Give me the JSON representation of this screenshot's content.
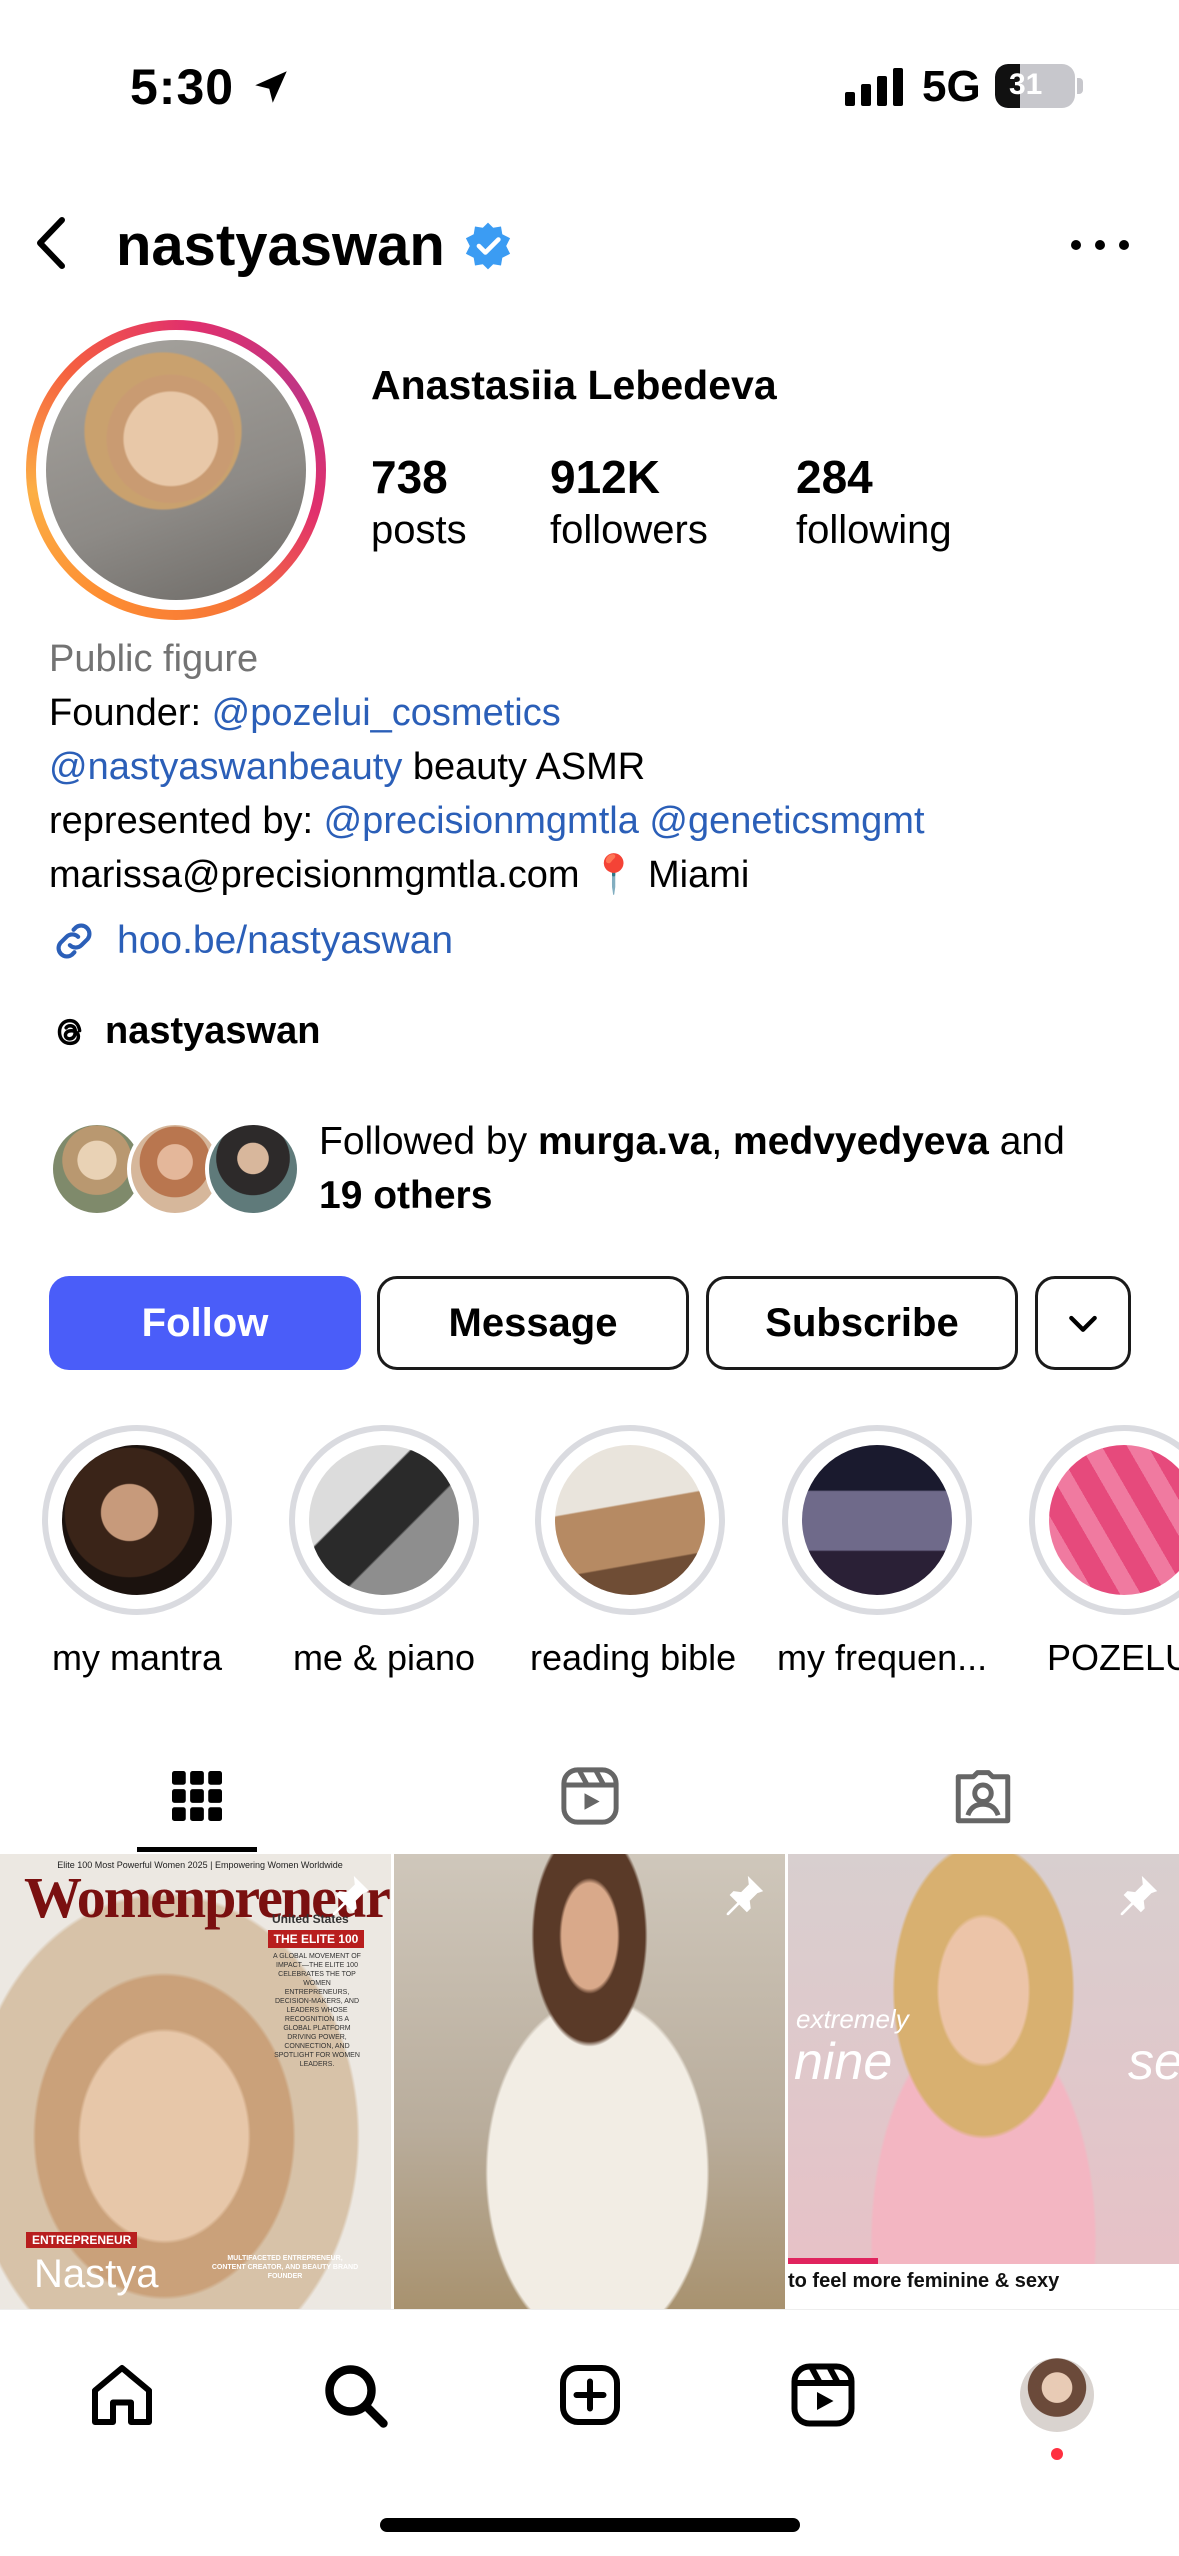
{
  "status_bar": {
    "time": "5:30",
    "network": "5G",
    "battery": "31",
    "battery_level": 0.31
  },
  "header": {
    "username": "nastyaswan"
  },
  "profile": {
    "full_name": "Anastasiia Lebedeva",
    "stats": [
      {
        "value": "738",
        "label": "posts"
      },
      {
        "value": "912K",
        "label": "followers"
      },
      {
        "value": "284",
        "label": "following"
      }
    ],
    "category": "Public figure",
    "bio": {
      "line1_prefix": "Founder: ",
      "line1_mention": "@pozelui_cosmetics",
      "line2_mention": "@nastyaswanbeauty",
      "line2_suffix": " beauty ASMR",
      "line3_prefix": "represented by: ",
      "line3_mention1": "@precisionmgmtla",
      "line3_mention2": "@geneticsmgmt",
      "line4": "marissa@precisionmgmtla.com 📍 Miami"
    },
    "link": "hoo.be/nastyaswan",
    "threads_name": "nastyaswan",
    "followed_by": {
      "prefix": "Followed by ",
      "user1": "murga.va",
      "separator": ", ",
      "user2": "medvyedyeva",
      "and": " and",
      "others": "19 others"
    }
  },
  "buttons": {
    "follow": "Follow",
    "message": "Message",
    "subscribe": "Subscribe"
  },
  "highlights": [
    {
      "label": "my mantra"
    },
    {
      "label": "me & piano"
    },
    {
      "label": "reading bible"
    },
    {
      "label": "my frequen..."
    },
    {
      "label": "POZELUI"
    }
  ],
  "grid": {
    "post1": {
      "masthead": "Womenpreneur",
      "top_line": "Elite 100 Most Powerful Women 2025 | Empowering Women Worldwide",
      "edition": "United States",
      "badge": "THE ELITE 100",
      "blurb": "A GLOBAL MOVEMENT OF IMPACT—THE ELITE 100 CELEBRATES THE TOP WOMEN ENTREPRENEURS, DECISION-MAKERS, AND LEADERS WHOSE RECOGNITION IS A GLOBAL PLATFORM DRIVING POWER, CONNECTION, AND SPOTLIGHT FOR WOMEN LEADERS.",
      "tag": "ENTREPRENEUR",
      "name": "Nastya",
      "footer": "MULTIFACETED ENTREPRENEUR, CONTENT CREATOR, AND BEAUTY BRAND FOUNDER"
    },
    "post3": {
      "overlay1": "extremely",
      "overlay2": "nine",
      "overlay3": "se",
      "caption": "to feel more feminine & sexy"
    }
  },
  "colors": {
    "follow_button": "#4a5df9",
    "link": "#2b5fb8",
    "verified": "#3b9cf3",
    "notification_dot": "#ff3040"
  }
}
